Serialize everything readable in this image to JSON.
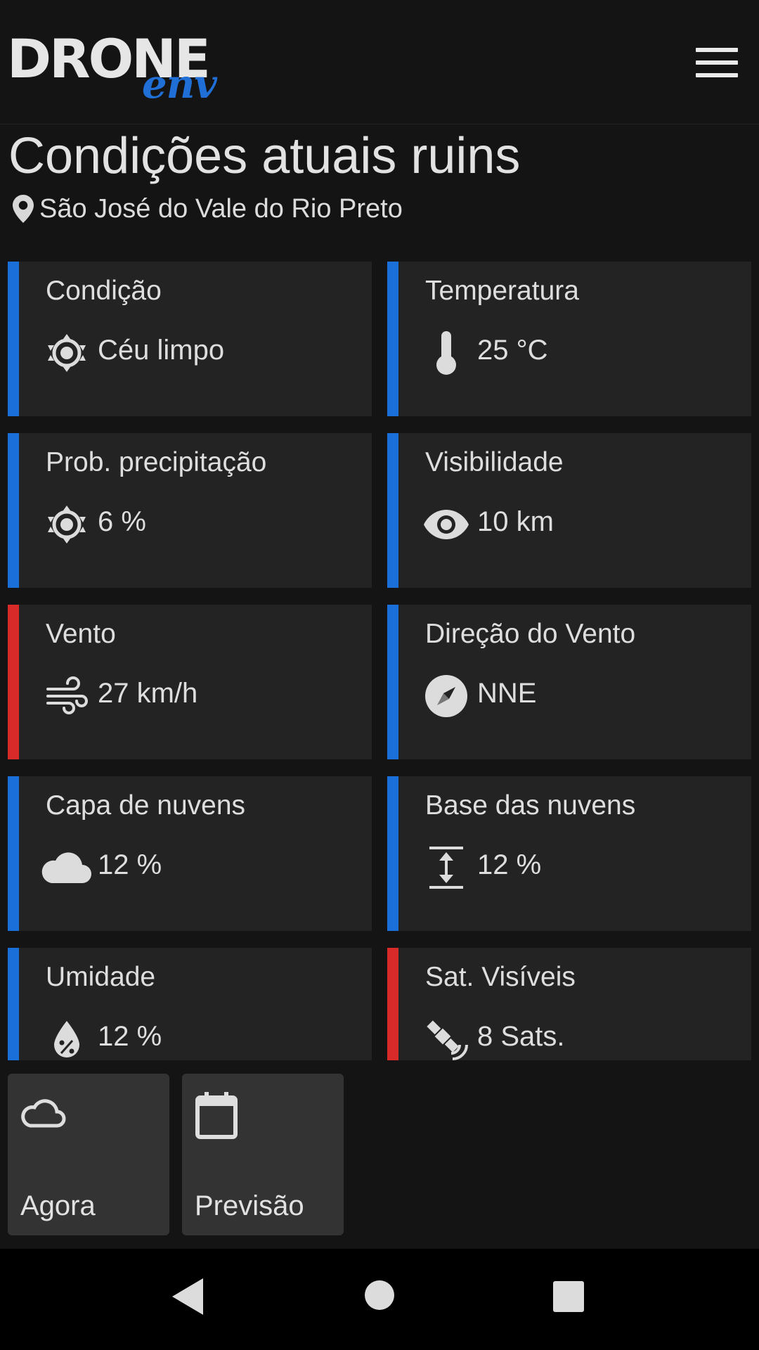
{
  "app": {
    "logo_main": "DRONE",
    "logo_sub": "env",
    "menu_icon": "hamburger-menu-icon",
    "brand_color": "#1f6fd6"
  },
  "page": {
    "title": "Condições atuais ruins",
    "location": "São José do Vale do Rio Preto"
  },
  "colors": {
    "ok": "#1a6fd8",
    "bad": "#d92a2a"
  },
  "cards": [
    {
      "label": "Condição",
      "value": "Céu limpo",
      "icon": "sun-icon",
      "status": "ok"
    },
    {
      "label": "Temperatura",
      "value": "25 °C",
      "icon": "thermometer-icon",
      "status": "ok"
    },
    {
      "label": "Prob. precipitação",
      "value": "6 %",
      "icon": "sun-icon",
      "status": "ok"
    },
    {
      "label": "Visibilidade",
      "value": "10 km",
      "icon": "eye-icon",
      "status": "ok"
    },
    {
      "label": "Vento",
      "value": "27 km/h",
      "icon": "wind-icon",
      "status": "bad"
    },
    {
      "label": "Direção do Vento",
      "value": "NNE",
      "icon": "compass-icon",
      "status": "ok"
    },
    {
      "label": "Capa de nuvens",
      "value": "12 %",
      "icon": "cloud-icon",
      "status": "ok"
    },
    {
      "label": "Base das nuvens",
      "value": "12 %",
      "icon": "height-icon",
      "status": "ok"
    },
    {
      "label": "Umidade",
      "value": "12 %",
      "icon": "humidity-drop-icon",
      "status": "ok"
    },
    {
      "label": "Sat. Visíveis",
      "value": "8 Sats.",
      "icon": "satellite-icon",
      "status": "bad"
    }
  ],
  "nav": [
    {
      "label": "Agora",
      "icon": "cloud-outline-icon"
    },
    {
      "label": "Previsão",
      "icon": "calendar-icon"
    }
  ],
  "system_nav": [
    "back-icon",
    "home-icon",
    "recents-icon"
  ]
}
